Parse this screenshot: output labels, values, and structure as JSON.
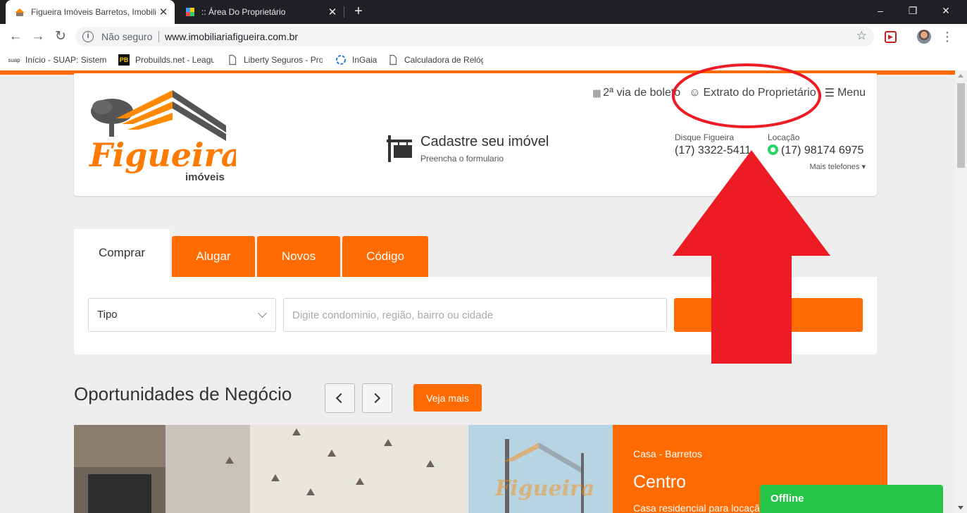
{
  "browser": {
    "tabs": [
      {
        "title": "Figueira Imóveis Barretos, Imobili",
        "active": true,
        "icon": "house-favicon"
      },
      {
        "title": ":: Área Do Proprietário",
        "active": false,
        "icon": "colorful-favicon"
      }
    ],
    "close_glyph": "✕",
    "new_tab_glyph": "+",
    "window_controls": {
      "minimize": "–",
      "maximize": "❐",
      "close": "✕"
    },
    "nav": {
      "back": "←",
      "forward": "→",
      "reload": "↻"
    },
    "security_label": "Não seguro",
    "url": "www.imobiliariafigueira.com.br",
    "bookmarks": [
      {
        "label": "Início - SUAP: Sistema",
        "icon": "suap-icon",
        "icon_text": "suap"
      },
      {
        "label": "Probuilds.net - League",
        "icon": "probuilds-icon",
        "icon_text": "PB"
      },
      {
        "label": "Liberty Seguros - Pro",
        "icon": "page-icon"
      },
      {
        "label": "InGaia",
        "icon": "ingaia-icon"
      },
      {
        "label": "Calculadora de Relóg",
        "icon": "page-icon"
      }
    ]
  },
  "header": {
    "logo_text": "Figueira",
    "logo_sub": "imóveis",
    "links": {
      "boleto": "2ª via de boleto",
      "extrato": "Extrato do Proprietário",
      "menu": "Menu"
    },
    "cadastre_title": "Cadastre seu imóvel",
    "cadastre_sub": "Preencha o formulario",
    "contacts": [
      {
        "label": "Disque Figueira",
        "number": "(17) 3322-5411"
      },
      {
        "label": "Locação",
        "number": "(17) 98174 6975"
      }
    ],
    "more_phones": "Mais telefones ▾"
  },
  "search": {
    "tabs": [
      "Comprar",
      "Alugar",
      "Novos",
      "Código"
    ],
    "active_tab": "Comprar",
    "type_select": "Tipo",
    "placeholder": "Digite condominio, região, bairro ou cidade",
    "button": "Buscar"
  },
  "opportunities": {
    "title": "Oportunidades de Negócio",
    "prev": "‹",
    "next": "›",
    "see_more": "Veja mais",
    "featured": {
      "type": "Casa -  Barretos",
      "name": "Centro",
      "description": "Casa residencial para locação"
    }
  },
  "chat": {
    "status": "Offline"
  },
  "colors": {
    "brand_orange": "#ff6b00",
    "annotation_red": "#ed1c24",
    "whatsapp_green": "#25d366",
    "chat_green": "#25c54a"
  }
}
